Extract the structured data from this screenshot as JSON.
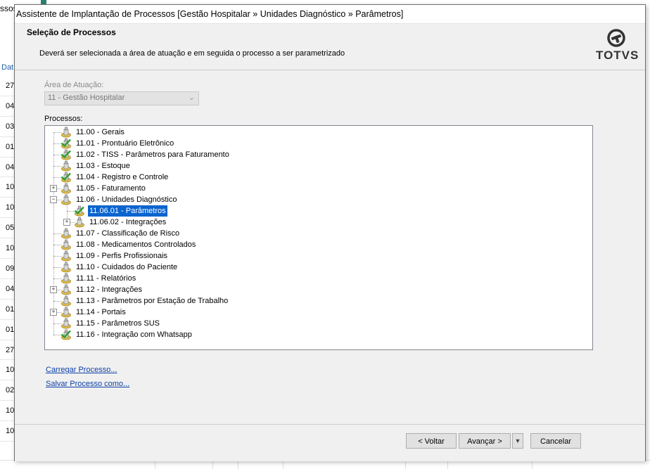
{
  "background": {
    "top_text": "ssos",
    "column_header": "Dat",
    "rows": [
      "27",
      "04",
      "03",
      "01",
      "04",
      "10",
      "10",
      "05",
      "10",
      "09",
      "04",
      "01",
      "01",
      "27",
      "10",
      "02",
      "10",
      "10"
    ]
  },
  "dialog": {
    "title": "Assistente de Implantação de Processos [Gestão Hospitalar » Unidades Diagnóstico » Parâmetros]",
    "heading": "Seleção de Processos",
    "description": "Deverá ser selecionada a área de atuação e em seguida o processo a ser parametrizado",
    "logo_text": "TOTVS",
    "area_label": "Área de Atuação:",
    "area_value": "11 - Gestão Hospitalar",
    "processes_label": "Processos:",
    "tree": [
      {
        "label": "11.00 - Gerais",
        "level": 0,
        "expander": "",
        "checked": false,
        "selected": false
      },
      {
        "label": "11.01 - Prontuário Eletrônico",
        "level": 0,
        "expander": "",
        "checked": true,
        "selected": false
      },
      {
        "label": "11.02 - TISS - Parâmetros para Faturamento",
        "level": 0,
        "expander": "",
        "checked": true,
        "selected": false
      },
      {
        "label": "11.03 - Estoque",
        "level": 0,
        "expander": "",
        "checked": false,
        "selected": false
      },
      {
        "label": "11.04 - Registro e Controle",
        "level": 0,
        "expander": "",
        "checked": true,
        "selected": false
      },
      {
        "label": "11.05 - Faturamento",
        "level": 0,
        "expander": "+",
        "checked": false,
        "selected": false
      },
      {
        "label": "11.06 - Unidades Diagnóstico",
        "level": 0,
        "expander": "-",
        "checked": false,
        "selected": false
      },
      {
        "label": "11.06.01 - Parâmetros",
        "level": 1,
        "expander": "",
        "checked": true,
        "selected": true
      },
      {
        "label": "11.06.02 - Integrações",
        "level": 1,
        "expander": "+",
        "checked": false,
        "selected": false
      },
      {
        "label": "11.07 - Classificação de Risco",
        "level": 0,
        "expander": "",
        "checked": false,
        "selected": false
      },
      {
        "label": "11.08 - Medicamentos Controlados",
        "level": 0,
        "expander": "",
        "checked": false,
        "selected": false
      },
      {
        "label": "11.09 - Perfis Profissionais",
        "level": 0,
        "expander": "",
        "checked": false,
        "selected": false
      },
      {
        "label": "11.10 - Cuidados do Paciente",
        "level": 0,
        "expander": "",
        "checked": false,
        "selected": false
      },
      {
        "label": "11.11 - Relatórios",
        "level": 0,
        "expander": "",
        "checked": false,
        "selected": false
      },
      {
        "label": "11.12 - Integrações",
        "level": 0,
        "expander": "+",
        "checked": false,
        "selected": false
      },
      {
        "label": "11.13 - Parâmetros por Estação de Trabalho",
        "level": 0,
        "expander": "",
        "checked": false,
        "selected": false
      },
      {
        "label": "11.14 - Portais",
        "level": 0,
        "expander": "+",
        "checked": false,
        "selected": false
      },
      {
        "label": "11.15 - Parâmetros SUS",
        "level": 0,
        "expander": "",
        "checked": false,
        "selected": false
      },
      {
        "label": "11.16 - Integração com Whatsapp",
        "level": 0,
        "expander": "",
        "checked": true,
        "selected": false
      }
    ],
    "load_link": "Carregar Processo...",
    "save_link": "Salvar Processo como...",
    "back_button": "< Voltar",
    "next_button": "Avançar >",
    "cancel_button": "Cancelar",
    "colors": {
      "selection": "#0a64cf",
      "link": "#0b3fa8",
      "check": "#2f9e2f",
      "icon": "#e8c34a"
    }
  }
}
